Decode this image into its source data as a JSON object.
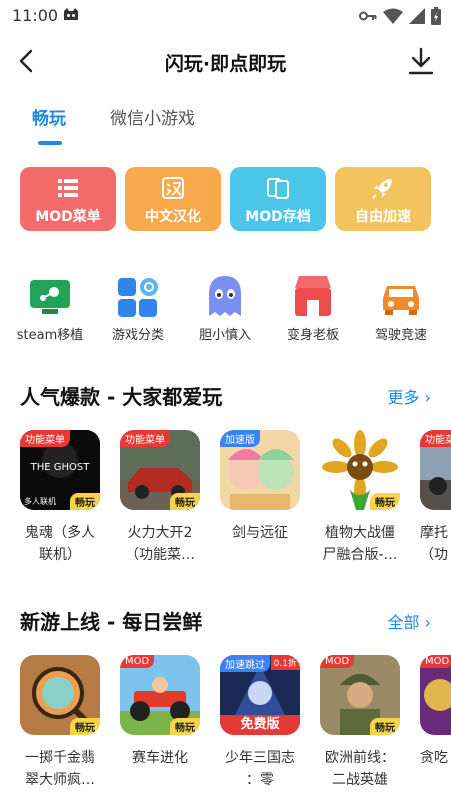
{
  "status_bar": {
    "time": "11:00"
  },
  "header": {
    "title": "闪玩·即点即玩"
  },
  "tabs": [
    {
      "label": "畅玩"
    },
    {
      "label": "微信小游戏"
    }
  ],
  "features": [
    {
      "label": "MOD菜单",
      "color": "#f46b6b",
      "icon": "list-icon"
    },
    {
      "label": "中文汉化",
      "color": "#f7a94c",
      "icon": "chinese-char-icon"
    },
    {
      "label": "MOD存档",
      "color": "#4bc6e8",
      "icon": "cards-icon"
    },
    {
      "label": "自由加速",
      "color": "#f2c45e",
      "icon": "rocket-icon"
    }
  ],
  "categories": [
    {
      "label": "steam移植",
      "icon": "steam-monitor-icon"
    },
    {
      "label": "游戏分类",
      "icon": "grid-search-icon"
    },
    {
      "label": "胆小慎入",
      "icon": "ghost-icon"
    },
    {
      "label": "变身老板",
      "icon": "shop-icon"
    },
    {
      "label": "驾驶竞速",
      "icon": "car-icon"
    }
  ],
  "sections": [
    {
      "title": "人气爆款 - 大家都爱玩",
      "more": "更多",
      "games": [
        {
          "name_line1": "鬼魂（多人",
          "name_line2": "联机）",
          "tag": "功能菜单",
          "badge": "畅玩",
          "icon_text": "THE GHOST",
          "icon_sub": "多人联机"
        },
        {
          "name_line1": "火力大开2",
          "name_line2": "（功能菜…",
          "tag": "功能菜单",
          "badge": "畅玩"
        },
        {
          "name_line1": "剑与远征",
          "name_line2": "",
          "tag": "加速版",
          "badge": ""
        },
        {
          "name_line1": "植物大战僵",
          "name_line2": "尸融合版-…",
          "tag": "",
          "badge": "畅玩"
        },
        {
          "name_line1": "摩托",
          "name_line2": "（功",
          "tag": "功能菜单",
          "badge": ""
        }
      ]
    },
    {
      "title": "新游上线 - 每日尝鲜",
      "more": "全部",
      "games": [
        {
          "name_line1": "一掷千金翡",
          "name_line2": "翠大师疯…",
          "tag": "",
          "badge": "畅玩"
        },
        {
          "name_line1": "赛车进化",
          "name_line2": "",
          "tag": "MOD",
          "badge": "畅玩"
        },
        {
          "name_line1": "少年三国志",
          "name_line2": "：零",
          "tag": "加速跳过",
          "badge": "",
          "tag2": "0.1折",
          "banner": "免费版"
        },
        {
          "name_line1": "欧洲前线：",
          "name_line2": "二战英雄",
          "tag": "MOD",
          "badge": "畅玩"
        },
        {
          "name_line1": "贪吃",
          "name_line2": "",
          "tag": "MOD",
          "badge": ""
        }
      ]
    }
  ],
  "colors": {
    "accent": "#1e88e5",
    "badge": "#f7d24a",
    "tag_red": "#e53935"
  }
}
